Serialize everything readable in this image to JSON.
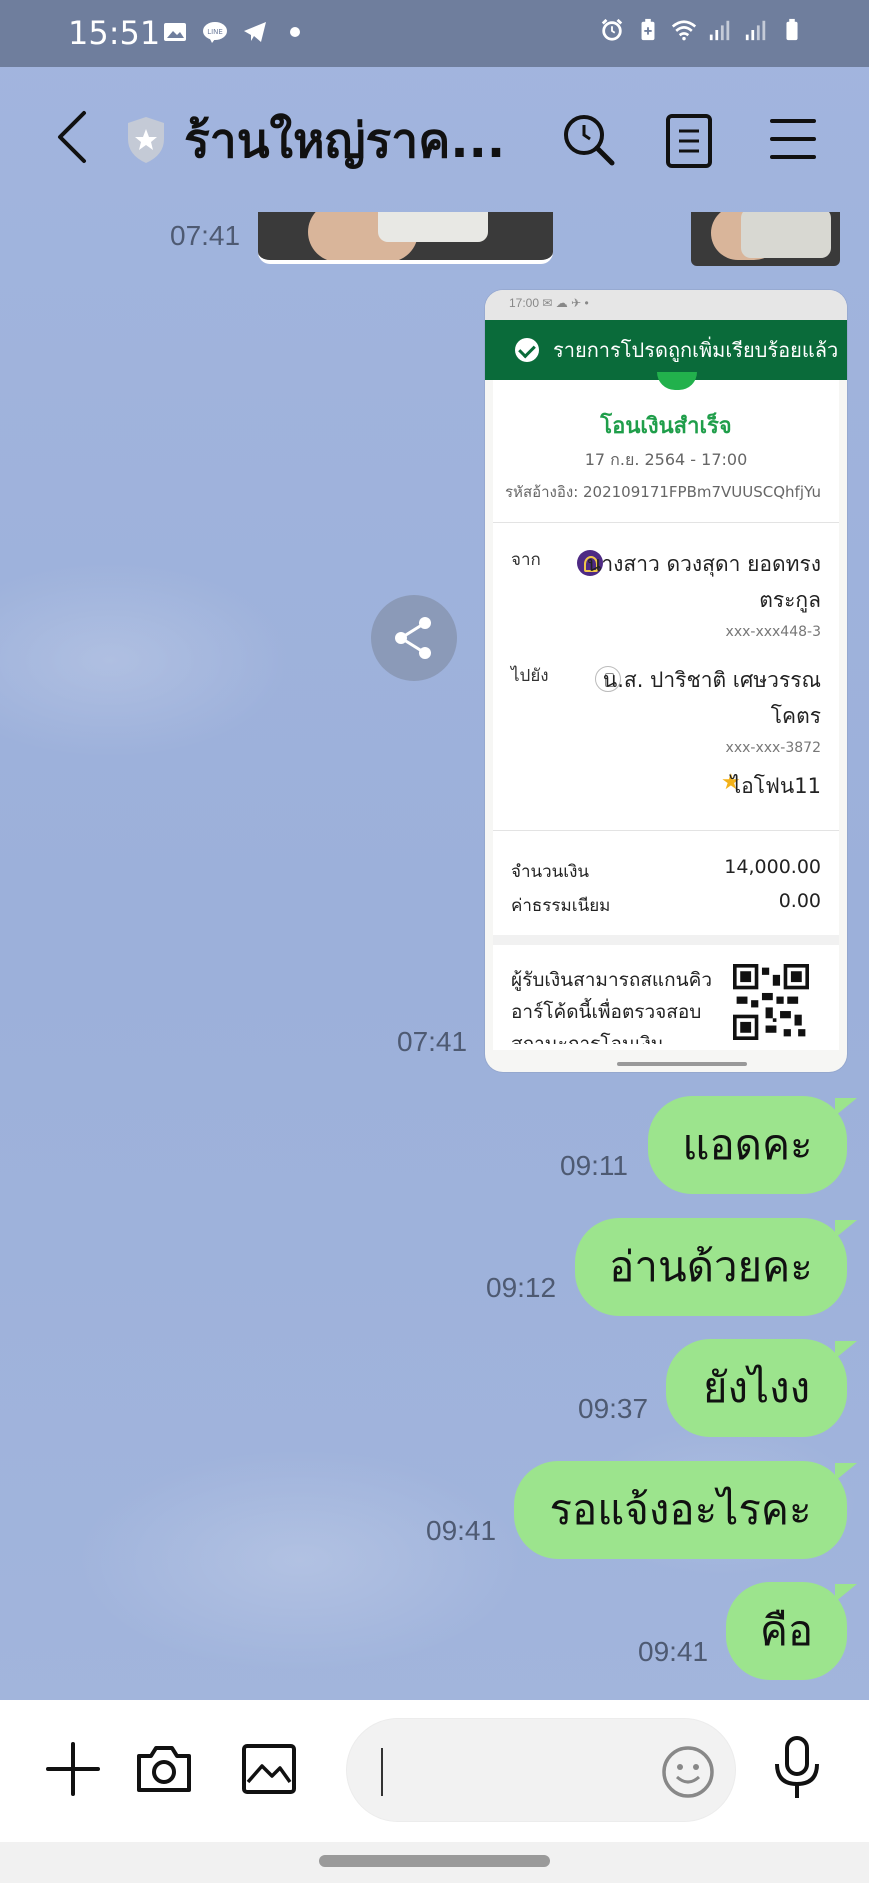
{
  "status_bar": {
    "time": "15:51",
    "left_icons": [
      "gallery-icon",
      "line-app-icon",
      "telegram-icon",
      "dot-icon"
    ],
    "right_icons": [
      "alarm-icon",
      "battery-saver-icon",
      "wifi-icon",
      "signal-icon",
      "signal-icon",
      "battery-icon"
    ]
  },
  "header": {
    "title": "ร้านใหญ่ราค...",
    "icons": [
      "back-icon",
      "shield-star-icon",
      "search-icon",
      "notes-icon",
      "menu-icon"
    ]
  },
  "messages": {
    "image_time": "07:41",
    "receipt_time": "07:41",
    "receipt": {
      "status_bar_text": "17:00 ✉ ☁ ✈ •",
      "banner": "รายการโปรดถูกเพิ่มเรียบร้อยแล้ว",
      "success": "โอนเงินสำเร็จ",
      "date": "17 ก.ย. 2564 - 17:00",
      "ref": "รหัสอ้างอิง: 202109171FPBm7VUUSCQhfjYu",
      "from_label": "จาก",
      "from_name_line1": "นางสาว ดวงสุดา ยอดทรง",
      "from_name_line2": "ตระกูล",
      "from_account": "xxx-xxx448-3",
      "to_label": "ไปยัง",
      "to_name_line1": "น.ส. ปาริชาติ เศษวรรณ",
      "to_name_line2": "โคตร",
      "to_account": "xxx-xxx-3872",
      "favorite_name": "ไอโฟน11",
      "amount_label": "จำนวนเงิน",
      "amount_value": "14,000.00",
      "fee_label": "ค่าธรรมเนียม",
      "fee_value": "0.00",
      "qr_text_line1": "ผู้รับเงินสามารถสแกนคิว",
      "qr_text_line2": "อาร์โค้ดนี้เพื่อตรวจสอบ",
      "qr_text_line3": "สถานะการโอนเงิน"
    },
    "bubbles": [
      {
        "text": "แอดคะ",
        "time": "09:11"
      },
      {
        "text": "อ่านด้วยคะ",
        "time": "09:12"
      },
      {
        "text": "ยังไงง",
        "time": "09:37"
      },
      {
        "text": "รอแจ้งอะไรคะ",
        "time": "09:41"
      },
      {
        "text": "คือ",
        "time": "09:41"
      }
    ]
  },
  "input_bar": {
    "icons": [
      "plus-icon",
      "camera-icon",
      "image-icon",
      "emoji-icon",
      "microphone-icon"
    ],
    "placeholder": ""
  },
  "colors": {
    "chat_background": "#9fb3dc",
    "bubble_green": "#9ce48d",
    "status_bar": "#6f7e9d",
    "receipt_banner": "#0a6b3a",
    "success_green": "#1f9e4a"
  }
}
